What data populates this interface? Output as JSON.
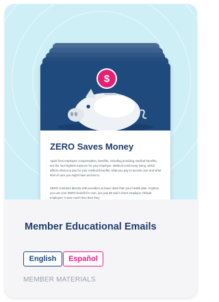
{
  "card": {
    "document": {
      "title": "ZERO Saves Money",
      "paragraph_1": "Apart from employee compensation, benefits, including providing medical benefits, are the next highest expense for your employer. Medical costs keep rising, which affects what you pay for your medical benefits, what you pay to access care and what kind of care you might have access to.",
      "paragraph_2": "ZERO contracts directly with providers at lower rates than your health plan. Anytime you use your ZERO benefit for care, you pay $0 and it insert employer 'default employee' it save much less than they",
      "coin_symbol": "$"
    },
    "title": "Member Educational Emails",
    "languages": [
      {
        "label": "English",
        "color": "#1e4a7e"
      },
      {
        "label": "Español",
        "color": "#e91e8c"
      }
    ],
    "category": "MEMBER MATERIALS"
  },
  "colors": {
    "hero_background": "#cfeff7",
    "document_header": "#1e4a7e",
    "title_text": "#1e3d6b",
    "accent_pink": "#e91e73"
  }
}
